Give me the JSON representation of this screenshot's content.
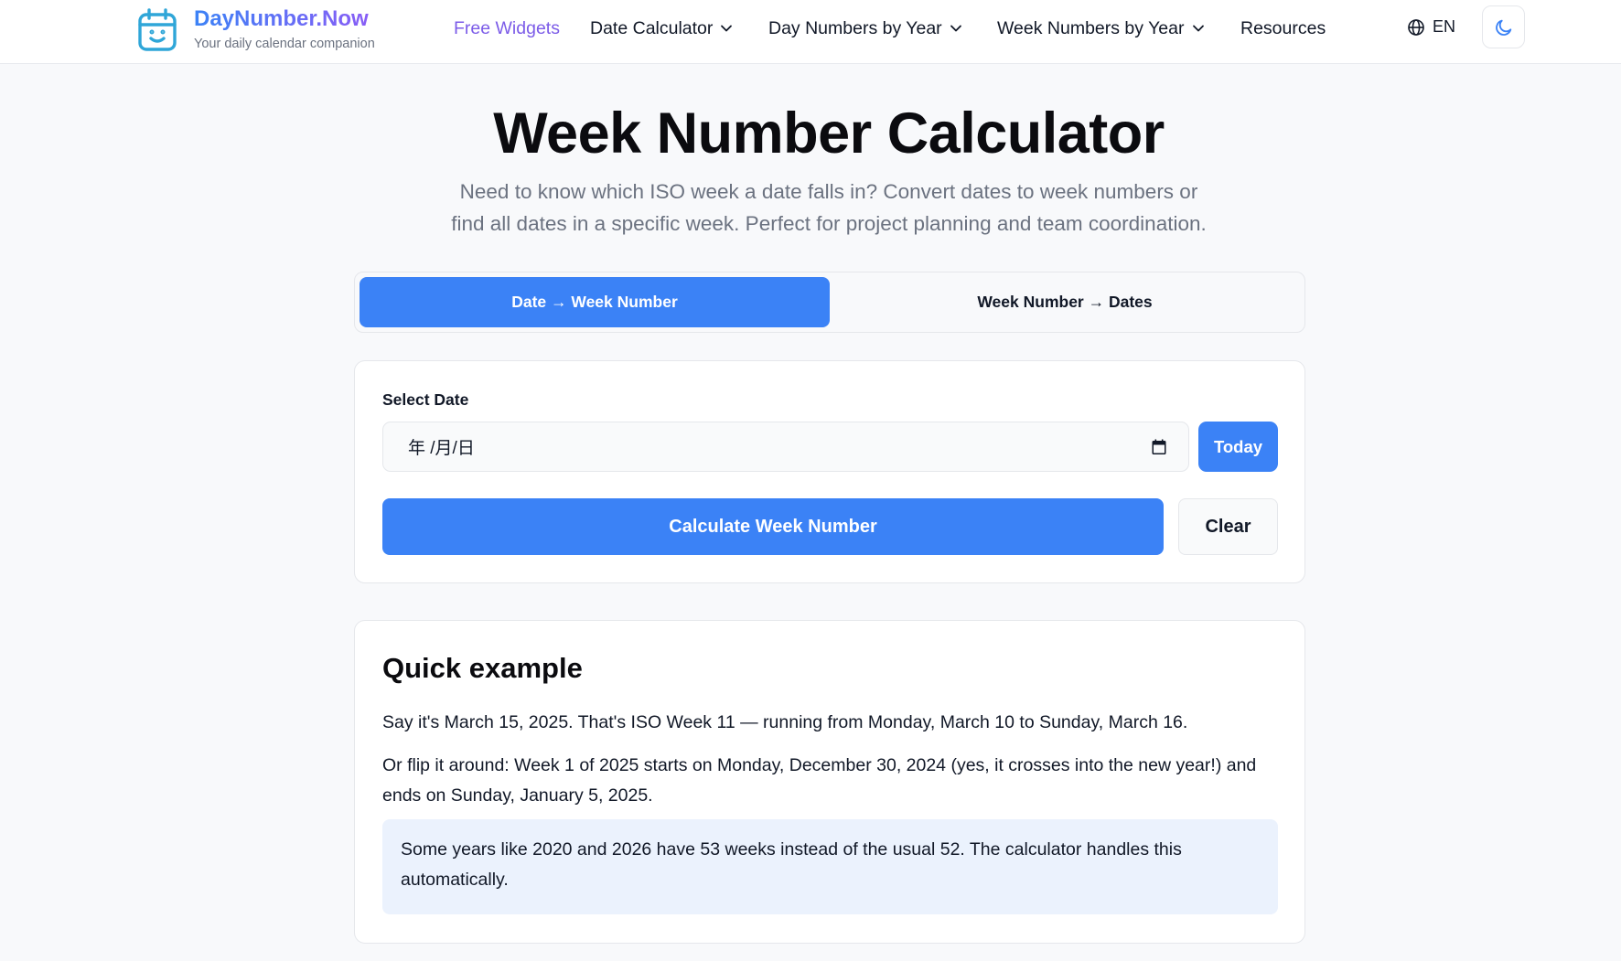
{
  "header": {
    "brand_name": "DayNumber.Now",
    "brand_tagline": "Your daily calendar companion",
    "nav": [
      {
        "label": "Free Widgets",
        "has_dropdown": false,
        "active": true
      },
      {
        "label": "Date Calculator",
        "has_dropdown": true
      },
      {
        "label": "Day Numbers by Year",
        "has_dropdown": true
      },
      {
        "label": "Week Numbers by Year",
        "has_dropdown": true
      },
      {
        "label": "Resources",
        "has_dropdown": false
      }
    ],
    "language": "EN",
    "theme_icon": "moon-icon"
  },
  "hero": {
    "title": "Week Number Calculator",
    "subtitle_line1": "Need to know which ISO week a date falls in? Convert dates to week numbers or",
    "subtitle_line2": "find all dates in a specific week. Perfect for project planning and team coordination."
  },
  "tabs": [
    {
      "label": "Date → Week Number",
      "active": true
    },
    {
      "label": "Week Number → Dates",
      "active": false
    }
  ],
  "calculator": {
    "field_label": "Select Date",
    "date_placeholder": "年 /月/日",
    "today_label": "Today",
    "calculate_label": "Calculate Week Number",
    "clear_label": "Clear"
  },
  "example": {
    "heading": "Quick example",
    "para1": "Say it's March 15, 2025. That's ISO Week 11 — running from Monday, March 10 to Sunday, March 16.",
    "para2": "Or flip it around: Week 1 of 2025 starts on Monday, December 30, 2024 (yes, it crosses into the new year!) and ends on Sunday, January 5, 2025.",
    "note": "Some years like 2020 and 2026 have 53 weeks instead of the usual 52. The calculator handles this automatically."
  },
  "colors": {
    "primary": "#3b82f6",
    "brand_gradient_start": "#3b82f6",
    "brand_gradient_end": "#8b5cf6",
    "active_nav": "#7c5ce8",
    "note_background": "#ebf2fd"
  }
}
